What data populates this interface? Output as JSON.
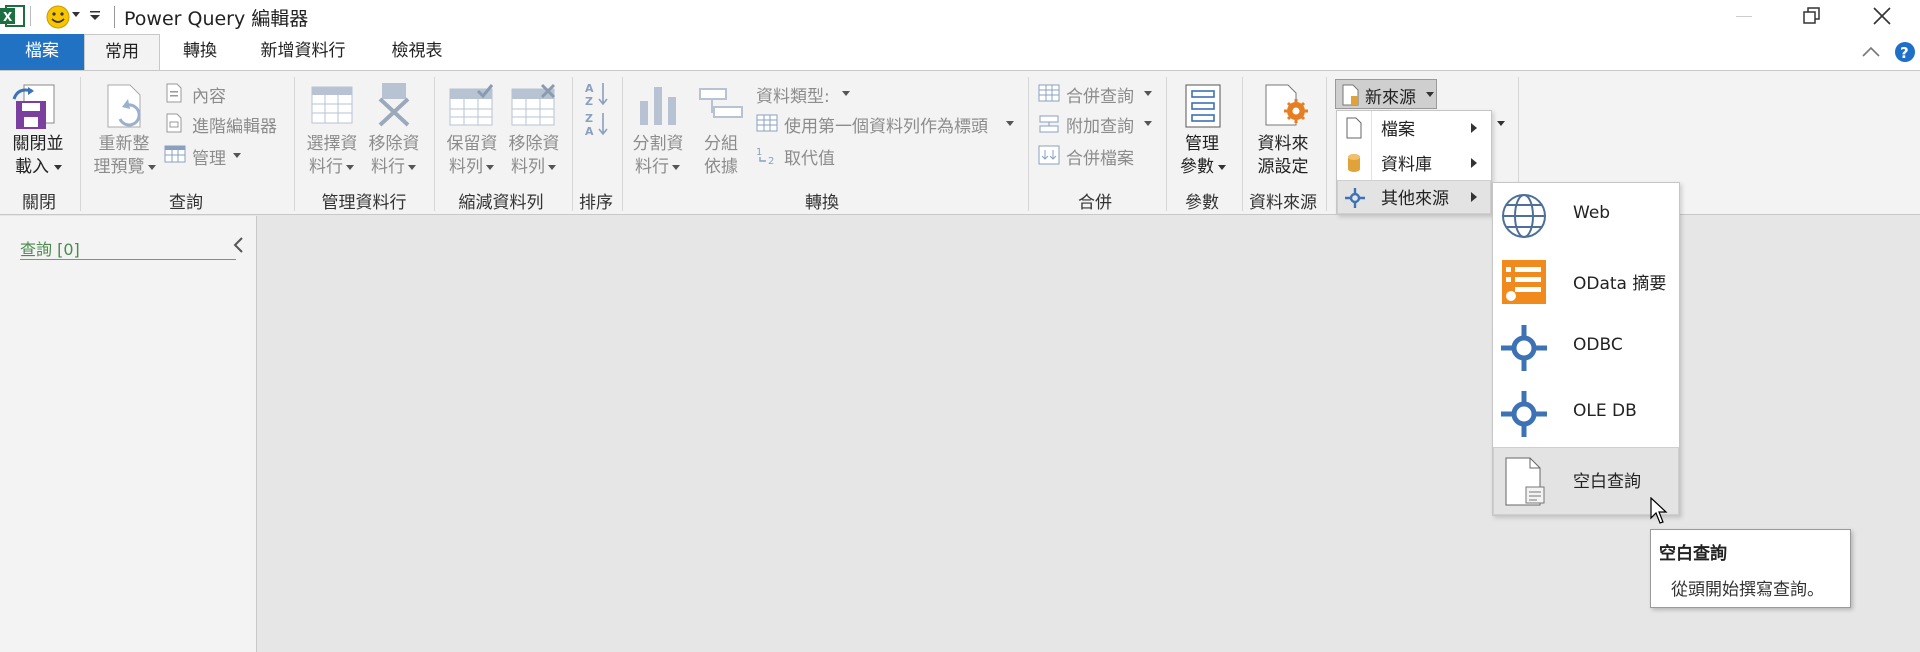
{
  "window": {
    "title": "Power Query 編輯器",
    "app_icon": "excel-icon",
    "quick_access_icon": "smiley-icon"
  },
  "tabs": [
    "檔案",
    "常用",
    "轉換",
    "新增資料行",
    "檢視表"
  ],
  "ribbon": {
    "close": {
      "button": [
        "關閉並",
        "載入"
      ],
      "group": "關閉"
    },
    "query": {
      "refresh": [
        "重新整",
        "理預覽"
      ],
      "properties": "內容",
      "advanced_editor": "進階編輯器",
      "manage": "管理",
      "group": "查詢"
    },
    "manage_columns": {
      "choose": [
        "選擇資",
        "料行"
      ],
      "remove": [
        "移除資",
        "料行"
      ],
      "group": "管理資料行"
    },
    "reduce_rows": {
      "keep": [
        "保留資",
        "料列"
      ],
      "remove": [
        "移除資",
        "料列"
      ],
      "group": "縮減資料列"
    },
    "sort": {
      "group": "排序"
    },
    "transform": {
      "split": [
        "分割資",
        "料行"
      ],
      "group_by": [
        "分組",
        "依據"
      ],
      "data_type": "資料類型:",
      "use_first_row": "使用第一個資料列作為標頭",
      "replace_values": "取代值",
      "group": "轉換"
    },
    "combine": {
      "merge": "合併查詢",
      "append": "附加查詢",
      "combine_files": "合併檔案",
      "group": "合併"
    },
    "parameters": {
      "manage": [
        "管理",
        "參數"
      ],
      "group": "參數"
    },
    "data_source": {
      "settings": [
        "資料來",
        "源設定"
      ],
      "group": "資料來源"
    },
    "new_source": {
      "label": "新來源"
    }
  },
  "queries_pane": {
    "label": "查詢 [0]"
  },
  "new_source_menu": [
    "檔案",
    "資料庫",
    "其他來源"
  ],
  "other_sources_menu": [
    "Web",
    "OData 摘要",
    "ODBC",
    "OLE DB",
    "空白查詢"
  ],
  "tooltip": {
    "title": "空白查詢",
    "body": "從頭開始撰寫查詢。"
  },
  "colors": {
    "file_tab": "#2272c3",
    "accent_blue": "#3d72b4",
    "odata_orange": "#f08a1c",
    "help_blue": "#1e6fc8"
  }
}
